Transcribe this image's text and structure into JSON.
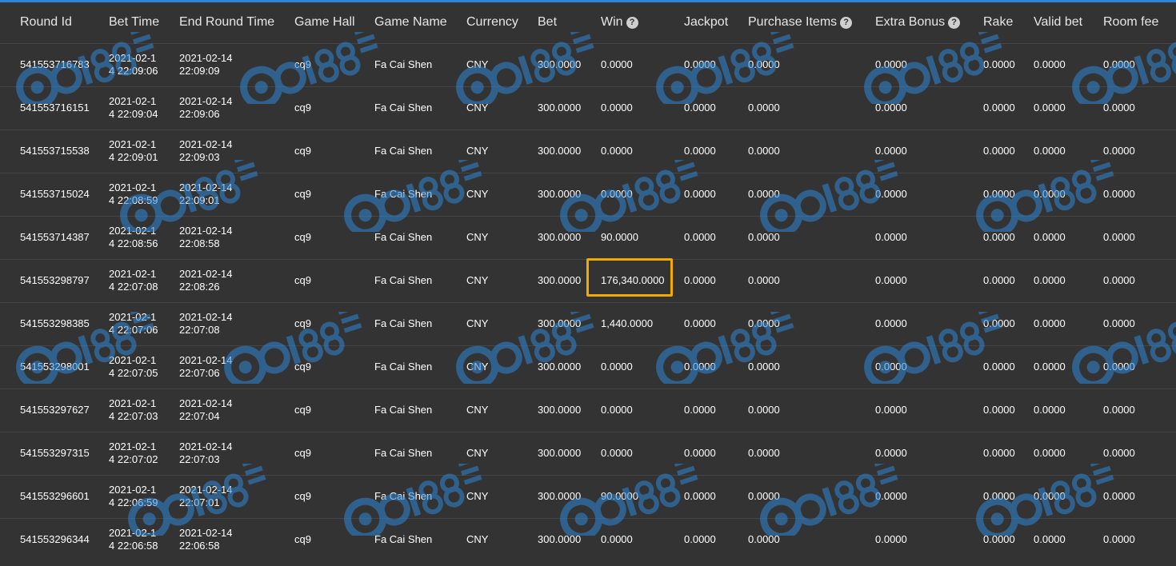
{
  "columns": [
    {
      "label": "Round Id",
      "help": false
    },
    {
      "label": "Bet Time",
      "help": false
    },
    {
      "label": "End Round Time",
      "help": false
    },
    {
      "label": "Game Hall",
      "help": false
    },
    {
      "label": "Game Name",
      "help": false
    },
    {
      "label": "Currency",
      "help": false
    },
    {
      "label": "Bet",
      "help": false
    },
    {
      "label": "Win",
      "help": true
    },
    {
      "label": "Jackpot",
      "help": false
    },
    {
      "label": "Purchase Items",
      "help": true
    },
    {
      "label": "Extra Bonus",
      "help": true
    },
    {
      "label": "Rake",
      "help": false
    },
    {
      "label": "Valid bet",
      "help": false
    },
    {
      "label": "Room fee",
      "help": false
    }
  ],
  "help_glyph": "?",
  "highlight_color": "#f2a900",
  "rows": [
    {
      "cells": [
        "541553716783",
        "2021-02-14 22:09:06",
        "2021-02-14 22:09:09",
        "cq9",
        "Fa Cai Shen",
        "CNY",
        "300.0000",
        "0.0000",
        "0.0000",
        "0.0000",
        "0.0000",
        "0.0000",
        "0.0000",
        "0.0000"
      ],
      "highlight": false
    },
    {
      "cells": [
        "541553716151",
        "2021-02-14 22:09:04",
        "2021-02-14 22:09:06",
        "cq9",
        "Fa Cai Shen",
        "CNY",
        "300.0000",
        "0.0000",
        "0.0000",
        "0.0000",
        "0.0000",
        "0.0000",
        "0.0000",
        "0.0000"
      ],
      "highlight": false
    },
    {
      "cells": [
        "541553715538",
        "2021-02-14 22:09:01",
        "2021-02-14 22:09:03",
        "cq9",
        "Fa Cai Shen",
        "CNY",
        "300.0000",
        "0.0000",
        "0.0000",
        "0.0000",
        "0.0000",
        "0.0000",
        "0.0000",
        "0.0000"
      ],
      "highlight": false
    },
    {
      "cells": [
        "541553715024",
        "2021-02-14 22:08:59",
        "2021-02-14 22:09:01",
        "cq9",
        "Fa Cai Shen",
        "CNY",
        "300.0000",
        "0.0000",
        "0.0000",
        "0.0000",
        "0.0000",
        "0.0000",
        "0.0000",
        "0.0000"
      ],
      "highlight": false
    },
    {
      "cells": [
        "541553714387",
        "2021-02-14 22:08:56",
        "2021-02-14 22:08:58",
        "cq9",
        "Fa Cai Shen",
        "CNY",
        "300.0000",
        "90.0000",
        "0.0000",
        "0.0000",
        "0.0000",
        "0.0000",
        "0.0000",
        "0.0000"
      ],
      "highlight": false
    },
    {
      "cells": [
        "541553298797",
        "2021-02-14 22:07:08",
        "2021-02-14 22:08:26",
        "cq9",
        "Fa Cai Shen",
        "CNY",
        "300.0000",
        "176,340.0000",
        "0.0000",
        "0.0000",
        "0.0000",
        "0.0000",
        "0.0000",
        "0.0000"
      ],
      "highlight": true
    },
    {
      "cells": [
        "541553298385",
        "2021-02-14 22:07:06",
        "2021-02-14 22:07:08",
        "cq9",
        "Fa Cai Shen",
        "CNY",
        "300.0000",
        "1,440.0000",
        "0.0000",
        "0.0000",
        "0.0000",
        "0.0000",
        "0.0000",
        "0.0000"
      ],
      "highlight": false
    },
    {
      "cells": [
        "541553298001",
        "2021-02-14 22:07:05",
        "2021-02-14 22:07:06",
        "cq9",
        "Fa Cai Shen",
        "CNY",
        "300.0000",
        "0.0000",
        "0.0000",
        "0.0000",
        "0.0000",
        "0.0000",
        "0.0000",
        "0.0000"
      ],
      "highlight": false
    },
    {
      "cells": [
        "541553297627",
        "2021-02-14 22:07:03",
        "2021-02-14 22:07:04",
        "cq9",
        "Fa Cai Shen",
        "CNY",
        "300.0000",
        "0.0000",
        "0.0000",
        "0.0000",
        "0.0000",
        "0.0000",
        "0.0000",
        "0.0000"
      ],
      "highlight": false
    },
    {
      "cells": [
        "541553297315",
        "2021-02-14 22:07:02",
        "2021-02-14 22:07:03",
        "cq9",
        "Fa Cai Shen",
        "CNY",
        "300.0000",
        "0.0000",
        "0.0000",
        "0.0000",
        "0.0000",
        "0.0000",
        "0.0000",
        "0.0000"
      ],
      "highlight": false
    },
    {
      "cells": [
        "541553296601",
        "2021-02-14 22:06:59",
        "2021-02-14 22:07:01",
        "cq9",
        "Fa Cai Shen",
        "CNY",
        "300.0000",
        "90.0000",
        "0.0000",
        "0.0000",
        "0.0000",
        "0.0000",
        "0.0000",
        "0.0000"
      ],
      "highlight": false
    },
    {
      "cells": [
        "541553296344",
        "2021-02-14 22:06:58",
        "2021-02-14 22:06:58",
        "cq9",
        "Fa Cai Shen",
        "CNY",
        "300.0000",
        "0.0000",
        "0.0000",
        "0.0000",
        "0.0000",
        "0.0000",
        "0.0000",
        "0.0000"
      ],
      "highlight": false
    }
  ]
}
